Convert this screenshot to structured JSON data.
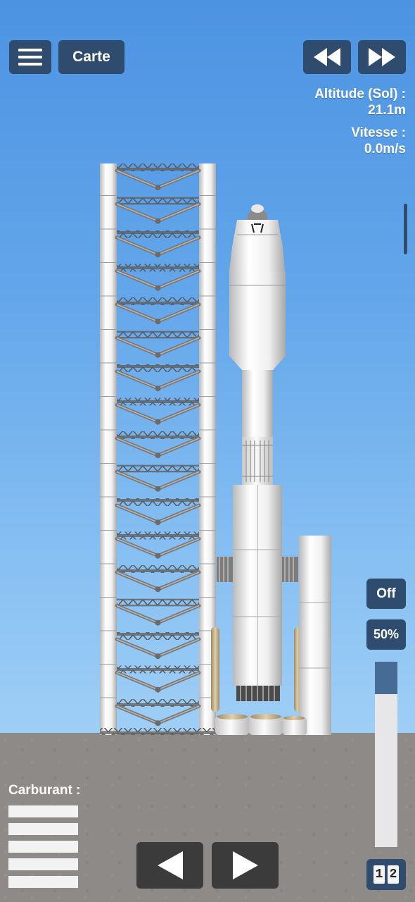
{
  "toolbar": {
    "menu_icon": "hamburger-menu-icon",
    "map_label": "Carte",
    "rewind_icon": "rewind-icon",
    "fast_forward_icon": "fast-forward-icon"
  },
  "telemetry": {
    "altitude_label": "Altitude (Sol) :",
    "altitude_value": "21.1m",
    "speed_label": "Vitesse :",
    "speed_value": "0.0m/s"
  },
  "controls": {
    "rcs_label": "Off",
    "throttle_label": "50%",
    "throttle_percent": 50,
    "stage_digits": [
      "1",
      "2"
    ]
  },
  "fuel": {
    "label": "Carburant :",
    "bar_count": 5
  },
  "nav": {
    "left_icon": "arrow-left-icon",
    "right_icon": "arrow-right-icon"
  },
  "colors": {
    "button_bg": "#2f4b6e",
    "sky_top": "#4c93e2",
    "sky_bottom": "#9fcff6",
    "ground": "#8d8a87"
  }
}
